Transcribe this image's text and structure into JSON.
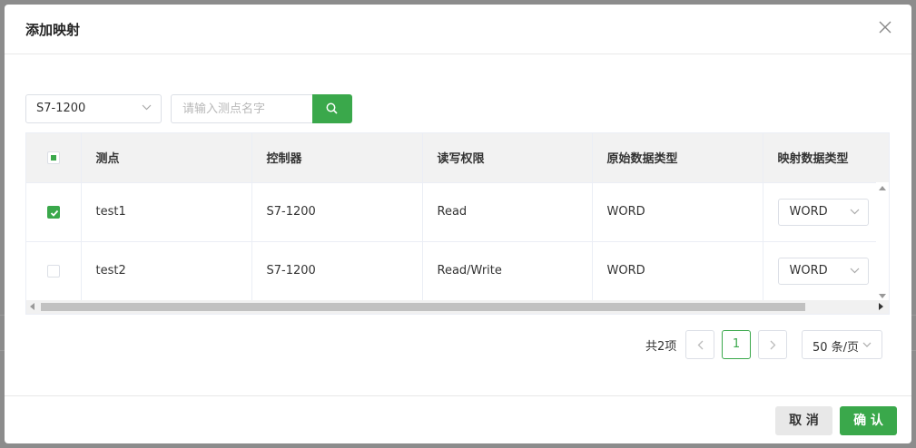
{
  "dialog": {
    "title": "添加映射",
    "close_icon": "close-icon"
  },
  "toolbar": {
    "plc_select_value": "S7-1200",
    "search_placeholder": "请输入测点名字",
    "search_icon": "search-icon"
  },
  "table": {
    "columns": [
      "测点",
      "控制器",
      "读写权限",
      "原始数据类型",
      "映射数据类型"
    ],
    "header_checkbox": "indeterminate",
    "rows": [
      {
        "checked": true,
        "point": "test1",
        "controller": "S7-1200",
        "access": "Read",
        "raw_type": "WORD",
        "mapped_type": "WORD"
      },
      {
        "checked": false,
        "point": "test2",
        "controller": "S7-1200",
        "access": "Read/Write",
        "raw_type": "WORD",
        "mapped_type": "WORD"
      }
    ]
  },
  "pagination": {
    "total_text": "共2项",
    "current_page": "1",
    "page_size": "50 条/页"
  },
  "footer": {
    "cancel_label": "取 消",
    "confirm_label": "确 认"
  },
  "colors": {
    "accent": "#3aa84b",
    "cancel_bg": "#e8e8e8",
    "header_bg": "#f2f2f2"
  }
}
